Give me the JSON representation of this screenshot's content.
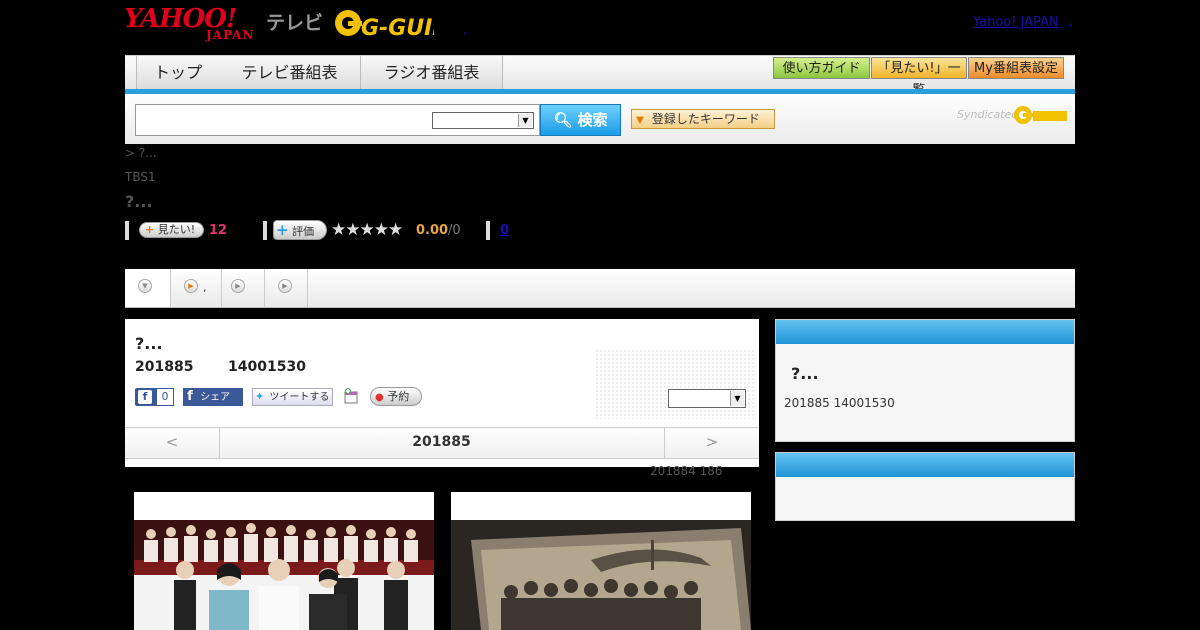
{
  "header": {
    "yahoo_logo_main": "YAHOO!",
    "yahoo_logo_sub": "JAPAN",
    "terebi": "テレビ",
    "gguide_logo": "G-GUIDE",
    "yahoo_japan_link": "Yahoo! JAPAN",
    "dot1": ",",
    "dot2": ","
  },
  "nav": {
    "tabs": [
      {
        "label": "トップ"
      },
      {
        "label": "テレビ番組表"
      },
      {
        "label": "ラジオ番組表"
      }
    ],
    "guide_label": "使い方ガイド",
    "mitai_list_label": "「見たい!」一覧",
    "my_table_label": "My番組表設定"
  },
  "search": {
    "placeholder": "",
    "button_label": "検索",
    "keyword_button_label": "登録したキーワード",
    "syndicated_label": "Syndicated"
  },
  "program": {
    "breadcrumb": "> ?...",
    "channel": "TBS1",
    "title": "?...",
    "mitai_label": "見たい!",
    "mitai_count": "12",
    "hyoka_label": "評価",
    "stars": "★★★★★",
    "score": "0.00",
    "score_total": "/0",
    "comment_count": "0"
  },
  "tabs": {
    "tab2_label": ","
  },
  "main": {
    "title": "?...",
    "date": "201885",
    "time": "14001530",
    "fb_like_count": "0",
    "fb_share_label": "シェア",
    "tweet_label": "ツイートする",
    "yoyaku_label": "予約",
    "date_prev": "<",
    "date_current": "201885",
    "date_next": ">",
    "note": "201884  186"
  },
  "side": {
    "title": "?...",
    "date_time": "201885  14001530"
  },
  "colors": {
    "accent_blue": "#2a9fde",
    "brand_red": "#e0001b",
    "mitai_pink": "#e3316e",
    "score_orange": "#e5a44a"
  }
}
